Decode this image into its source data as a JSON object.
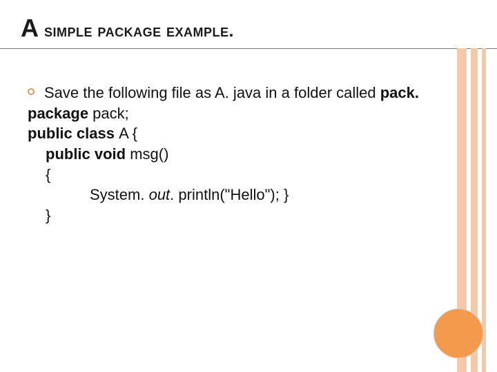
{
  "title": {
    "first": "A",
    "rest": " simple package example."
  },
  "bullet": {
    "lead": "Save the following file as A. java in a folder called ",
    "bold_tail": "pack."
  },
  "code": {
    "l1": {
      "kw": "package ",
      "rest": "pack;"
    },
    "l2": {
      "kw": "public class ",
      "rest": "A {"
    },
    "l3": {
      "kw": "public void ",
      "rest": "msg()"
    },
    "l4": "{",
    "l5": {
      "a": "System. ",
      "i": "out",
      "b": ". println(\"Hello\"); }"
    },
    "l6": "}"
  }
}
